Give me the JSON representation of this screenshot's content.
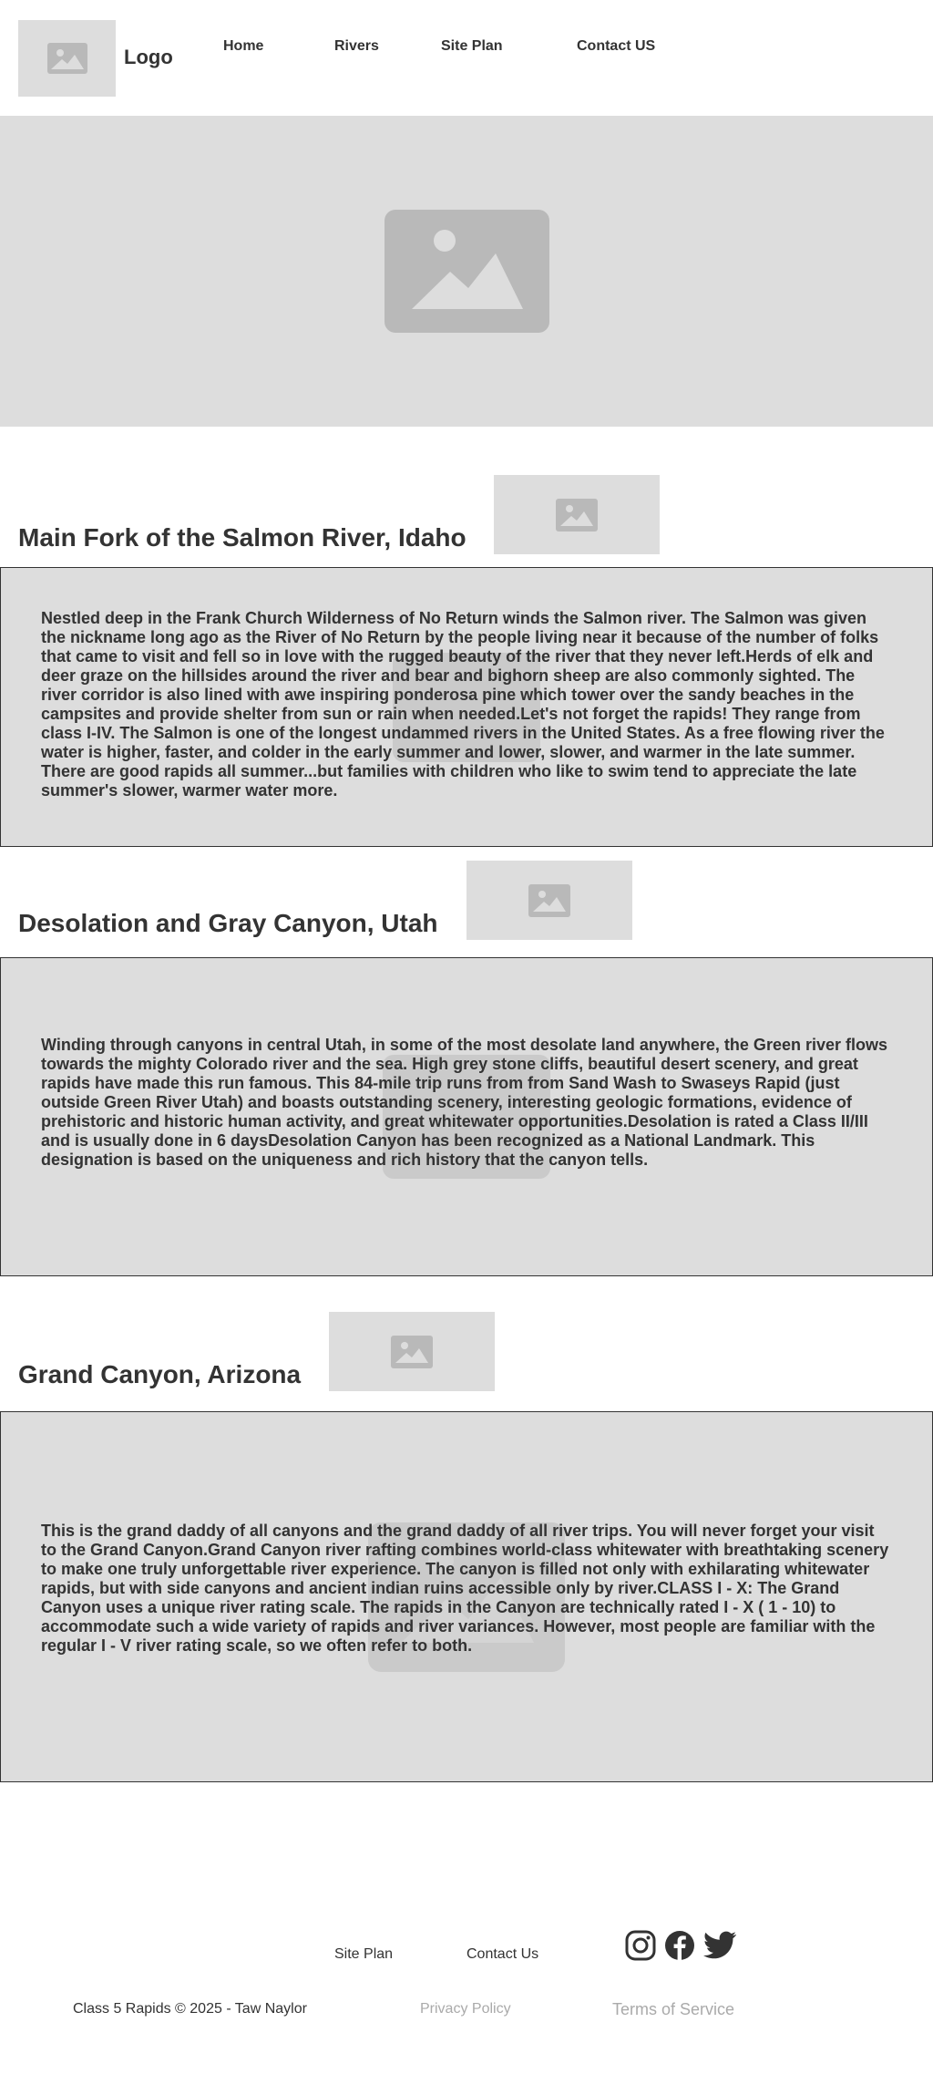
{
  "header": {
    "logo_text": "Logo",
    "nav": [
      {
        "label": "Home"
      },
      {
        "label": "Rivers"
      },
      {
        "label": "Site Plan"
      },
      {
        "label": "Contact US"
      }
    ]
  },
  "sections": [
    {
      "title": "Main Fork of the Salmon River, Idaho",
      "body": "Nestled deep in the Frank Church Wilderness of No Return winds the Salmon river. The Salmon was given the nickname long ago as the River of No Return by the people living near it because of the number of folks that came to visit and fell so in love with the rugged beauty of the river that they never left.Herds of elk and deer graze on the hillsides around the river and bear and bighorn sheep are also commonly sighted. The river corridor is also lined with awe inspiring ponderosa pine which tower over the sandy beaches in the campsites and provide shelter from sun or rain when needed.Let's not forget the rapids! They range from class I-IV. The Salmon is one of the longest undammed rivers in the United States. As a free flowing river the water is higher, faster, and colder in the early summer and lower, slower, and warmer in the late summer. There are good rapids all summer...but families with children who like to swim tend to appreciate the late summer's slower, warmer water more."
    },
    {
      "title": "Desolation and Gray Canyon, Utah",
      "body": "Winding through canyons in central Utah, in some of the most desolate land anywhere, the Green river flows towards the mighty Colorado river and the sea. High grey stone cliffs, beautiful desert scenery, and great rapids have made this run famous. This 84-mile trip runs from from Sand Wash to Swaseys Rapid (just outside Green River Utah) and boasts outstanding scenery, interesting geologic formations, evidence of prehistoric and historic human activity, and great whitewater opportunities.Desolation is rated a Class II/III and is usually done in 6 daysDesolation Canyon has been recognized as a National Landmark. This designation is based on the uniqueness and rich history that the canyon tells."
    },
    {
      "title": "Grand Canyon, Arizona",
      "body": "This is the grand daddy of all canyons and the grand daddy of all river trips. You will never forget your visit to the Grand Canyon.Grand Canyon river rafting combines world-class whitewater with breathtaking scenery to make one truly unforgettable river experience. The canyon is filled not only with exhilarating whitewater rapids, but with side canyons and ancient indian ruins accessible only by river.CLASS I - X: The Grand Canyon uses a unique river rating scale. The rapids in the Canyon are technically rated I - X ( 1 - 10) to accommodate such a wide variety of rapids and river variances. However, most people are familiar with the regular I - V river rating scale, so we often refer to both."
    }
  ],
  "footer": {
    "links": [
      {
        "label": "Site Plan"
      },
      {
        "label": "Contact Us"
      }
    ],
    "social": [
      "instagram-icon",
      "facebook-icon",
      "twitter-icon"
    ],
    "copyright": "Class 5 Rapids © 2025 - Taw Naylor",
    "privacy": "Privacy Policy",
    "terms": "Terms of Service"
  },
  "colors": {
    "placeholder_bg": "#dddddd",
    "placeholder_icon": "#b9b9b9",
    "text": "#333333",
    "muted": "#aaaaaa"
  }
}
